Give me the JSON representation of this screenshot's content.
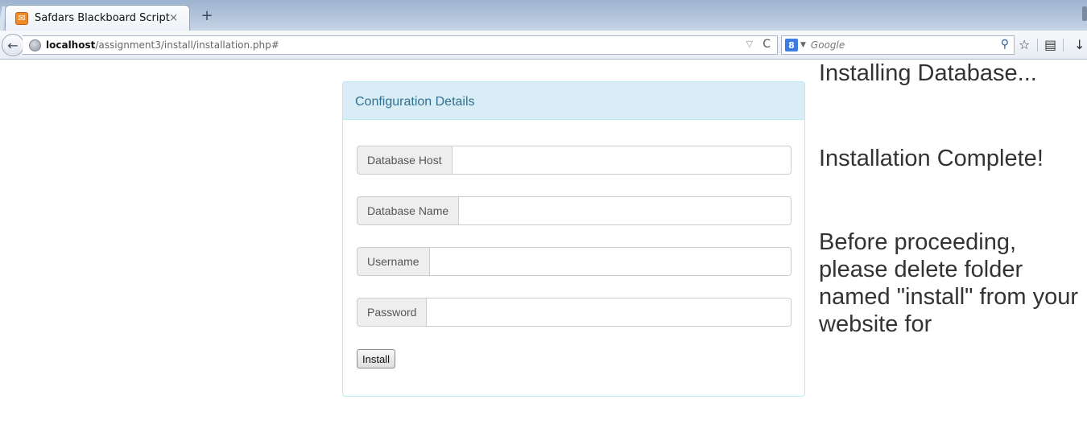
{
  "browser": {
    "tab": {
      "title": "Safdars Blackboard Script",
      "close_glyph": "×",
      "favicon_glyph": "✉"
    },
    "new_tab_glyph": "+",
    "url": {
      "host": "localhost",
      "path": "/assignment3/install/installation.php#"
    },
    "search": {
      "engine_glyph": "8",
      "placeholder": "Google"
    },
    "icons": {
      "back": "←",
      "reload": "C",
      "dropmarker": "▽",
      "search_go": "⚲",
      "bookmark": "☆",
      "reading_list": "▤",
      "download": "↓"
    }
  },
  "panel": {
    "heading": "Configuration Details",
    "fields": [
      {
        "label": "Database Host",
        "value": ""
      },
      {
        "label": "Database Name",
        "value": ""
      },
      {
        "label": "Username",
        "value": ""
      },
      {
        "label": "Password",
        "value": ""
      }
    ],
    "install_label": "Install"
  },
  "status": {
    "installing": "Installing Database...",
    "complete": "Installation Complete!",
    "notice": "Before proceeding, please delete folder named \"install\" from your website for"
  },
  "colors": {
    "panel_heading_bg": "#d9edf7",
    "panel_heading_text": "#31708f",
    "panel_border": "#bce8f1",
    "addon_bg": "#eeeeee"
  }
}
